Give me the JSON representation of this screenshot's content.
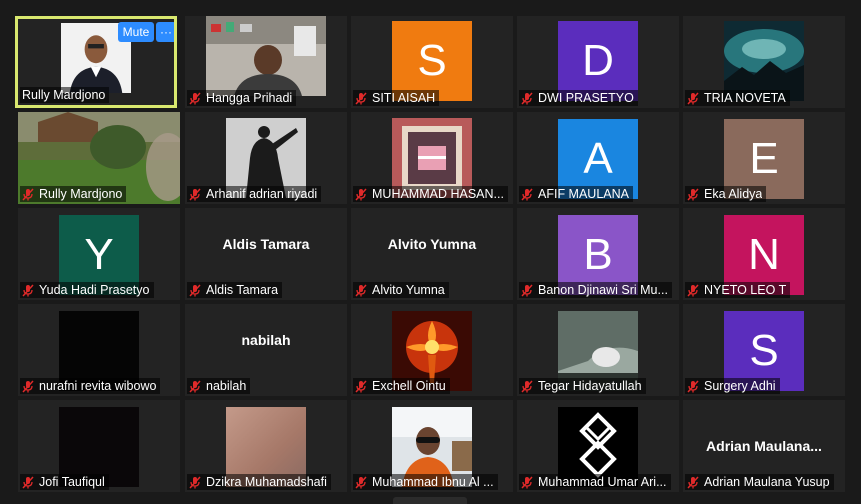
{
  "tile_controls": {
    "mute_label": "Mute",
    "more_label": "···"
  },
  "participants": [
    {
      "name": "Rully Mardjono",
      "type": "video",
      "muted": false,
      "active": true
    },
    {
      "name": "Hangga Prihadi",
      "type": "video",
      "muted": true
    },
    {
      "name": "SITI AISAH",
      "type": "letter",
      "letter": "S",
      "color": "#f07b10",
      "muted": true
    },
    {
      "name": "DWI PRASETYO",
      "type": "letter",
      "letter": "D",
      "color": "#5b2dbd",
      "muted": true
    },
    {
      "name": "TRIA NOVETA",
      "type": "video",
      "muted": true
    },
    {
      "name": "Rully Mardjono",
      "type": "video",
      "muted": true
    },
    {
      "name": "Arhanif adrian riyadi",
      "type": "video",
      "muted": true
    },
    {
      "name": "MUHAMMAD HASAN...",
      "type": "video",
      "muted": true
    },
    {
      "name": "AFIF MAULANA",
      "type": "letter",
      "letter": "A",
      "color": "#1a86e0",
      "muted": true
    },
    {
      "name": "Eka Alidya",
      "type": "letter",
      "letter": "E",
      "color": "#8a6a5c",
      "muted": true
    },
    {
      "name": "Yuda Hadi Prasetyo",
      "type": "letter",
      "letter": "Y",
      "color": "#0d5c4a",
      "muted": true
    },
    {
      "name": "Aldis Tamara",
      "type": "name",
      "display": "Aldis Tamara",
      "muted": true
    },
    {
      "name": "Alvito Yumna",
      "type": "name",
      "display": "Alvito Yumna",
      "muted": true
    },
    {
      "name": "Banon Djinawi Sri Mu...",
      "type": "letter",
      "letter": "B",
      "color": "#8a55c8",
      "muted": true
    },
    {
      "name": "NYETO LEO T",
      "type": "letter",
      "letter": "N",
      "color": "#c4145e",
      "muted": true
    },
    {
      "name": "nurafni revita wibowo",
      "type": "video",
      "muted": true
    },
    {
      "name": "nabilah",
      "type": "name",
      "display": "nabilah",
      "muted": true
    },
    {
      "name": "Exchell Ointu",
      "type": "video",
      "muted": true
    },
    {
      "name": "Tegar Hidayatullah",
      "type": "video",
      "muted": true
    },
    {
      "name": "Surgery Adhi",
      "type": "letter",
      "letter": "S",
      "color": "#5b2dbd",
      "muted": true
    },
    {
      "name": "Jofi Taufiqul",
      "type": "video",
      "muted": true
    },
    {
      "name": "Dzikra Muhamadshafi",
      "type": "video",
      "muted": true
    },
    {
      "name": "Muhammad Ibnu Al ...",
      "type": "video",
      "muted": true
    },
    {
      "name": "Muhammad Umar Ari...",
      "type": "video",
      "muted": true
    },
    {
      "name": "Adrian Maulana Yusup",
      "type": "name",
      "display": "Adrian  Maulana...",
      "muted": true
    }
  ]
}
